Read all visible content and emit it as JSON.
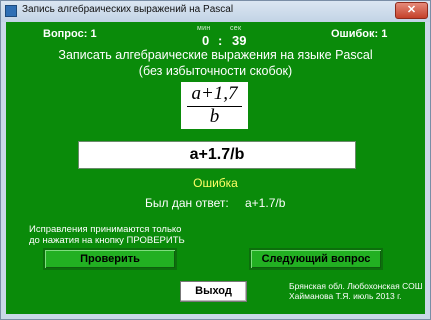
{
  "window": {
    "title": "Запись алгебраических выражений на  Pascal",
    "close_label": "✕"
  },
  "status": {
    "question_label": "Вопрос: 1",
    "errors_label": "Ошибок: 1"
  },
  "timer": {
    "min_label": "мин",
    "sec_label": "сек",
    "minutes": "0",
    "separator": ":",
    "seconds": "39"
  },
  "task": {
    "line1": "Записать алгебраические выражения на языке Pascal",
    "line2": "(без избыточности скобок)"
  },
  "formula": {
    "numerator": "a+1,7",
    "denominator": "b"
  },
  "answer_field": {
    "value": "a+1.7/b"
  },
  "result": {
    "status": "Ошибка",
    "given_label": "Был дан ответ:",
    "given_value": "a+1.7/b",
    "status_color": "#ffff66"
  },
  "note": {
    "line1": "Исправления принимаются только",
    "line2": "до нажатия на кнопку ПРОВЕРИТЬ"
  },
  "buttons": {
    "check": "Проверить",
    "next": "Следующий вопрос",
    "exit": "Выход"
  },
  "credits": {
    "line1": "Брянская обл. Любохонская СОШ",
    "line2": "Хайманова Т.Я. июль 2013 г."
  }
}
